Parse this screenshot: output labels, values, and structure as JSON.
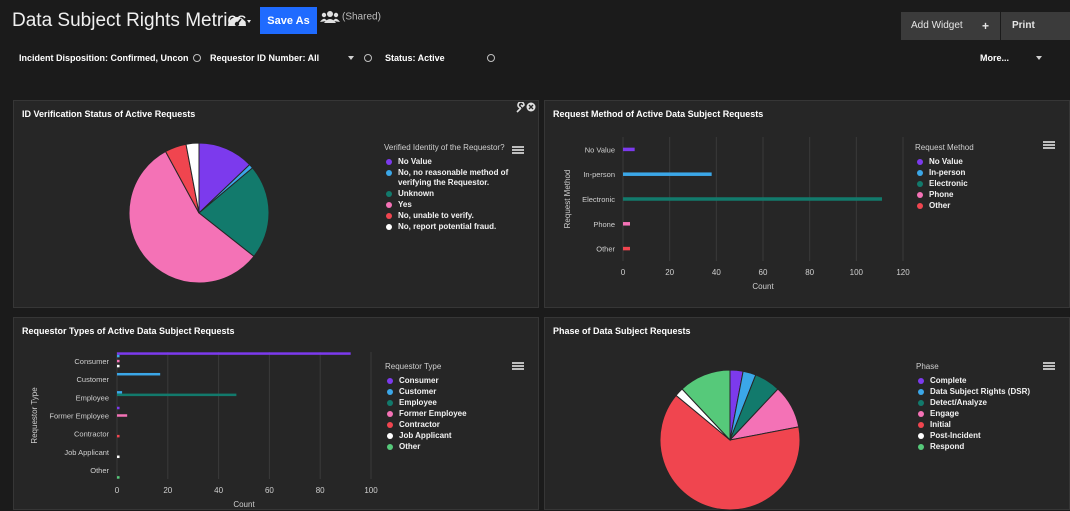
{
  "header": {
    "title": "Data Subject Rights Metrics",
    "save_as": "Save As",
    "shared": "(Shared)",
    "add_widget": "Add Widget",
    "add_plus": "+",
    "print": "Print"
  },
  "filters": {
    "incident_disposition": "Incident Disposition: Confirmed, Uncon",
    "requestor_id": "Requestor ID Number: All",
    "status": "Status: Active",
    "more": "More..."
  },
  "colors": {
    "purple": "#7c3aed",
    "blue": "#3ba7e8",
    "teal": "#127a6c",
    "pink": "#f472b6",
    "red": "#f0454f",
    "white": "#ffffff",
    "green": "#56c97a"
  },
  "panels": {
    "id_verification": {
      "title": "ID Verification Status of Active Requests",
      "legend_title": "Verified Identity of the Requestor?",
      "legend": [
        {
          "label": "No Value",
          "color": "#7c3aed"
        },
        {
          "label": "No, no reasonable method of verifying the Requestor.",
          "color": "#3ba7e8"
        },
        {
          "label": "Unknown",
          "color": "#127a6c"
        },
        {
          "label": "Yes",
          "color": "#f472b6"
        },
        {
          "label": "No, unable to verify.",
          "color": "#f0454f"
        },
        {
          "label": "No, report potential fraud.",
          "color": "#ffffff"
        }
      ]
    },
    "request_method": {
      "title": "Request Method of Active Data Subject Requests",
      "legend_title": "Request Method",
      "legend": [
        {
          "label": "No Value",
          "color": "#7c3aed"
        },
        {
          "label": "In-person",
          "color": "#3ba7e8"
        },
        {
          "label": "Electronic",
          "color": "#127a6c"
        },
        {
          "label": "Phone",
          "color": "#f472b6"
        },
        {
          "label": "Other",
          "color": "#f0454f"
        }
      ]
    },
    "requestor_types": {
      "title": "Requestor Types of Active Data Subject Requests",
      "legend_title": "Requestor Type",
      "legend": [
        {
          "label": "Consumer",
          "color": "#7c3aed"
        },
        {
          "label": "Customer",
          "color": "#3ba7e8"
        },
        {
          "label": "Employee",
          "color": "#127a6c"
        },
        {
          "label": "Former Employee",
          "color": "#f472b6"
        },
        {
          "label": "Contractor",
          "color": "#f0454f"
        },
        {
          "label": "Job Applicant",
          "color": "#ffffff"
        },
        {
          "label": "Other",
          "color": "#56c97a"
        }
      ]
    },
    "phase": {
      "title": "Phase of Data Subject Requests",
      "legend_title": "Phase",
      "legend": [
        {
          "label": "Complete",
          "color": "#7c3aed"
        },
        {
          "label": "Data Subject Rights (DSR)",
          "color": "#3ba7e8"
        },
        {
          "label": "Detect/Analyze",
          "color": "#127a6c"
        },
        {
          "label": "Engage",
          "color": "#f472b6"
        },
        {
          "label": "Initial",
          "color": "#f0454f"
        },
        {
          "label": "Post-Incident",
          "color": "#ffffff"
        },
        {
          "label": "Respond",
          "color": "#56c97a"
        }
      ]
    }
  },
  "chart_data": [
    {
      "type": "pie",
      "title": "ID Verification Status of Active Requests",
      "categories": [
        "No Value",
        "No, no reasonable method of verifying the Requestor.",
        "Unknown",
        "Yes",
        "No, unable to verify.",
        "No, report potential fraud."
      ],
      "values": [
        13,
        1,
        22,
        57,
        5,
        3
      ],
      "colors": [
        "#7c3aed",
        "#3ba7e8",
        "#127a6c",
        "#f472b6",
        "#f0454f",
        "#ffffff"
      ]
    },
    {
      "type": "bar",
      "orientation": "horizontal",
      "title": "Request Method of Active Data Subject Requests",
      "categories": [
        "No Value",
        "In-person",
        "Electronic",
        "Phone",
        "Other"
      ],
      "values": [
        5,
        38,
        111,
        3,
        3
      ],
      "colors": [
        "#7c3aed",
        "#3ba7e8",
        "#127a6c",
        "#f472b6",
        "#f0454f"
      ],
      "xlabel": "Count",
      "ylabel": "Request Method",
      "xlim": [
        0,
        120
      ],
      "xticks": [
        0,
        20,
        40,
        60,
        80,
        100,
        120
      ]
    },
    {
      "type": "bar",
      "orientation": "horizontal",
      "title": "Requestor Types of Active Data Subject Requests",
      "categories": [
        "Consumer",
        "Customer",
        "Employee",
        "Former Employee",
        "Contractor",
        "Job Applicant",
        "Other"
      ],
      "series": [
        {
          "name": "Consumer",
          "values": [
            92,
            0,
            0,
            1,
            0,
            0,
            0
          ]
        },
        {
          "name": "Customer",
          "values": [
            1,
            17,
            2,
            0,
            0,
            0,
            0
          ]
        },
        {
          "name": "Employee",
          "values": [
            0,
            0,
            47,
            0,
            0,
            0,
            0
          ]
        },
        {
          "name": "Former Employee",
          "values": [
            1,
            0,
            0,
            4,
            0,
            0,
            0
          ]
        },
        {
          "name": "Contractor",
          "values": [
            0,
            0,
            0,
            0,
            1,
            0,
            0
          ]
        },
        {
          "name": "Job Applicant",
          "values": [
            1,
            0,
            0,
            0,
            0,
            1,
            0
          ]
        },
        {
          "name": "Other",
          "values": [
            0,
            0,
            0,
            0,
            0,
            0,
            1
          ]
        }
      ],
      "colors": [
        "#7c3aed",
        "#3ba7e8",
        "#127a6c",
        "#f472b6",
        "#f0454f",
        "#ffffff",
        "#56c97a"
      ],
      "xlabel": "Count",
      "ylabel": "Requestor Type",
      "xlim": [
        0,
        100
      ],
      "xticks": [
        0,
        20,
        40,
        60,
        80,
        100
      ]
    },
    {
      "type": "pie",
      "title": "Phase of Data Subject Requests",
      "categories": [
        "Complete",
        "Data Subject Rights (DSR)",
        "Detect/Analyze",
        "Engage",
        "Initial",
        "Post-Incident",
        "Respond"
      ],
      "values": [
        3,
        3,
        6,
        10,
        64,
        2,
        12
      ],
      "colors": [
        "#7c3aed",
        "#3ba7e8",
        "#127a6c",
        "#f472b6",
        "#f0454f",
        "#ffffff",
        "#56c97a"
      ]
    }
  ]
}
